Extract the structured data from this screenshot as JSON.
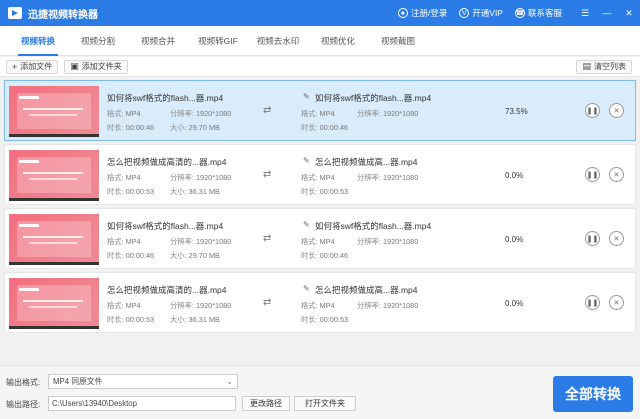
{
  "app": {
    "title": "迅捷视频转换器"
  },
  "titlebar": {
    "login": "注册/登录",
    "vip": "开通VIP",
    "service": "联系客服"
  },
  "tabs": [
    "视频转换",
    "视频分割",
    "视频合并",
    "视频转GIF",
    "视频去水印",
    "视频优化",
    "视频截图"
  ],
  "toolbar": {
    "add_file": "添加文件",
    "add_folder": "添加文件夹",
    "clear_list": "清空列表"
  },
  "labels": {
    "format": "格式:",
    "resolution": "分辨率:",
    "duration": "时长:",
    "size": "大小:"
  },
  "files": [
    {
      "src_name": "如何将swf格式的flash...器.mp4",
      "src_format": "MP4",
      "src_resolution": "1920*1080",
      "src_duration": "00:00:46",
      "src_size": "29.70 MB",
      "dst_name": "如何将swf格式的flash...器.mp4",
      "dst_format": "MP4",
      "dst_resolution": "1920*1080",
      "dst_duration": "00:00:46",
      "progress": "73.5%"
    },
    {
      "src_name": "怎么把视频做成高清的...器.mp4",
      "src_format": "MP4",
      "src_resolution": "1920*1080",
      "src_duration": "00:00:53",
      "src_size": "36.31 MB",
      "dst_name": "怎么把视频做成高...器.mp4",
      "dst_format": "MP4",
      "dst_resolution": "1920*1080",
      "dst_duration": "00:00:53",
      "progress": "0.0%"
    },
    {
      "src_name": "如何将swf格式的flash...器.mp4",
      "src_format": "MP4",
      "src_resolution": "1920*1080",
      "src_duration": "00:00:46",
      "src_size": "29.70 MB",
      "dst_name": "如何将swf格式的flash...器.mp4",
      "dst_format": "MP4",
      "dst_resolution": "1920*1080",
      "dst_duration": "00:00:46",
      "progress": "0.0%"
    },
    {
      "src_name": "怎么把视频做成高清的...器.mp4",
      "src_format": "MP4",
      "src_resolution": "1920*1080",
      "src_duration": "00:00:53",
      "src_size": "36.31 MB",
      "dst_name": "怎么把视频做成高...器.mp4",
      "dst_format": "MP4",
      "dst_resolution": "1920*1080",
      "dst_duration": "00:00:53",
      "progress": "0.0%"
    }
  ],
  "bottom": {
    "format_label": "输出格式:",
    "format_value": "MP4 同原文件",
    "path_label": "输出路径:",
    "path_value": "C:\\Users\\13940\\Desktop",
    "change_path": "更改路径",
    "open_folder": "打开文件夹",
    "start": "全部转换"
  },
  "colors": {
    "accent": "#2b7ce6",
    "selected_row": "#d9ecfb"
  },
  "icons": {
    "convert": "shuffle-icon",
    "edit": "pencil-icon",
    "pause": "pause-icon",
    "remove": "close-icon"
  }
}
